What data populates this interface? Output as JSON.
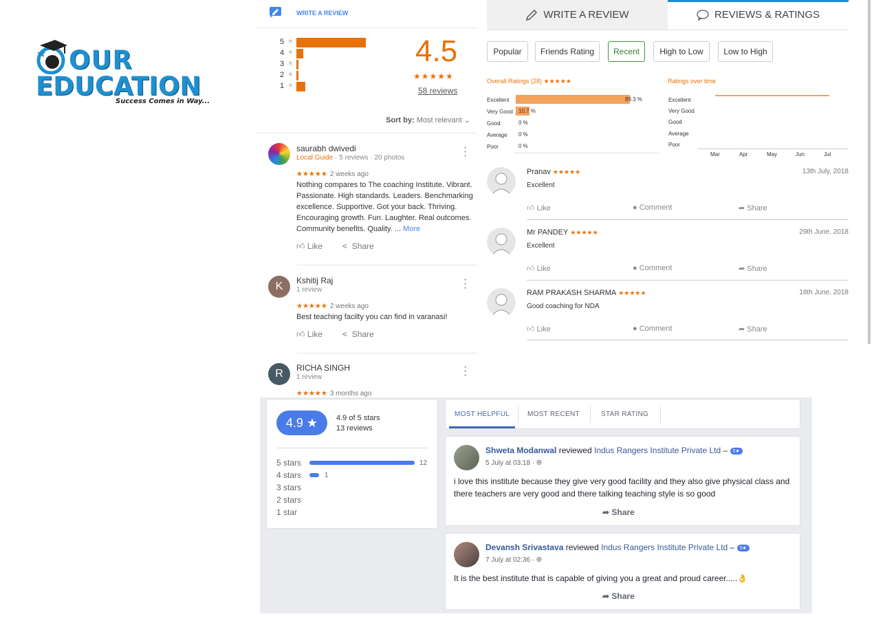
{
  "logo": {
    "line1": "OUR",
    "line2": "EDUCATION",
    "tagline": "Success Comes in Way..."
  },
  "google": {
    "write_label": "WRITE A REVIEW",
    "distribution": [
      {
        "stars": "5",
        "fraction": 0.62
      },
      {
        "stars": "4",
        "fraction": 0.06
      },
      {
        "stars": "3",
        "fraction": 0.02
      },
      {
        "stars": "2",
        "fraction": 0.0
      },
      {
        "stars": "1",
        "fraction": 0.08
      }
    ],
    "score": "4.5",
    "score_stars": "★★★★★",
    "review_count": "58 reviews",
    "sort_label": "Sort by:",
    "sort_value": "Most relevant",
    "reviews": [
      {
        "name": "saurabh dwivedi",
        "guide": "Local Guide",
        "sub": " · 5 reviews · 20 photos",
        "stars": "★★★★★",
        "time": "2 weeks ago",
        "text": "Nothing compares to The coaching Institute. Vibrant. Passionate. High standards. Leaders. Benchmarking excellence. Supportive. Got your back. Thriving. Encouraging growth. Fun. Laughter. Real outcomes. Community benefits. Quality. ...",
        "more": "More",
        "like": "Like",
        "share": "Share"
      },
      {
        "name": "Kshitij Raj",
        "initial": "K",
        "sub": "1 review",
        "stars": "★★★★★",
        "time": "2 weeks ago",
        "text": "Best teaching facilty you can find in varanasi!",
        "like": "Like",
        "share": "Share"
      },
      {
        "name": "RICHA SINGH",
        "initial": "R",
        "sub": "1 review",
        "stars": "★★★★★",
        "time": "3 months ago"
      }
    ]
  },
  "widget": {
    "tab_write": "WRITE A REVIEW",
    "tab_reviews": "REVIEWS & RATINGS",
    "filters": [
      "Popular",
      "Friends Rating",
      "Recent",
      "High to Low",
      "Low to High"
    ],
    "overall_title": "Overall Ratings (28)",
    "overall_stars": "★★★★★",
    "ratings": [
      {
        "label": "Excellent",
        "pct": "89.3 %",
        "value": 89.3
      },
      {
        "label": "Very Good",
        "pct": "10.7 %",
        "value": 10.7
      },
      {
        "label": "Good",
        "pct": "0 %",
        "value": 0
      },
      {
        "label": "Average",
        "pct": "0 %",
        "value": 0
      },
      {
        "label": "Poor",
        "pct": "0 %",
        "value": 0
      }
    ],
    "time_title": "Ratings over time",
    "time_labels": [
      "Excellent",
      "Very Good",
      "Good",
      "Average",
      "Poor"
    ],
    "months": [
      "Mar",
      "Apr",
      "May",
      "Jun",
      "Jul"
    ],
    "reviews": [
      {
        "name": "Pranav",
        "stars": "★★★★★",
        "date": "13th July, 2018",
        "text": "Excellent"
      },
      {
        "name": "Mr PANDEY",
        "stars": "★★★★★",
        "date": "29th June, 2018",
        "text": "Excellent"
      },
      {
        "name": "RAM PRAKASH SHARMA",
        "stars": "★★★★★",
        "date": "18th June, 2018",
        "text": "Good coaching for NDA"
      }
    ],
    "act_like": "Like",
    "act_comment": "Comment",
    "act_share": "Share"
  },
  "facebook": {
    "score": "4.9 ★",
    "of_stars": "4.9 of 5 stars",
    "review_count": "13 reviews",
    "dist": [
      {
        "label": "5 stars",
        "count": "12",
        "fraction": 1.0
      },
      {
        "label": "4 stars",
        "count": "1",
        "fraction": 0.09
      },
      {
        "label": "3 stars",
        "count": "",
        "fraction": 0
      },
      {
        "label": "2 stars",
        "count": "",
        "fraction": 0
      },
      {
        "label": "1 star",
        "count": "",
        "fraction": 0
      }
    ],
    "tabs": [
      "MOST HELPFUL",
      "MOST RECENT",
      "STAR RATING"
    ],
    "posts": [
      {
        "name": "Shweta Modanwal",
        "verb": " reviewed ",
        "page": "Indus Rangers Institute Private Ltd",
        "dash": " – ",
        "badge": "5★",
        "time": "5 July at 03:18 ·",
        "text": "i love this institute because they give very good facility and they also give physical class and there teachers are very good and there talking teaching style is so good",
        "share": "Share"
      },
      {
        "name": "Devansh Srivastava",
        "verb": " reviewed ",
        "page": "Indus Rangers Institute Private Ltd",
        "dash": " – ",
        "badge": "5★",
        "time": "7 July at 02:36 ·",
        "text": "It is the best institute that is capable of giving you a great and proud career.....👌",
        "share": "Share"
      }
    ]
  }
}
